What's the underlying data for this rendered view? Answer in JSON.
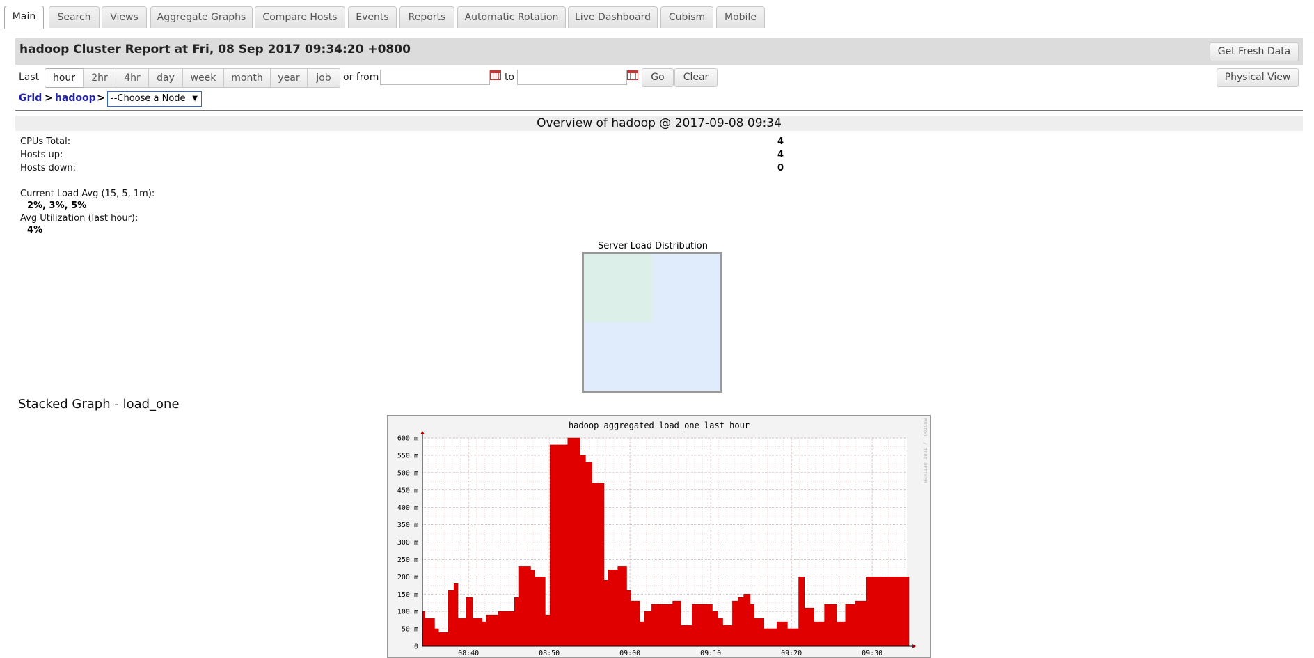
{
  "tabs": [
    {
      "label": "Main",
      "active": true
    },
    {
      "label": "Search"
    },
    {
      "label": "Views"
    },
    {
      "label": "Aggregate Graphs"
    },
    {
      "label": "Compare Hosts"
    },
    {
      "label": "Events"
    },
    {
      "label": "Reports"
    },
    {
      "label": "Automatic Rotation"
    },
    {
      "label": "Live Dashboard"
    },
    {
      "label": "Cubism"
    },
    {
      "label": "Mobile"
    }
  ],
  "header": {
    "title": "hadoop Cluster Report at Fri, 08 Sep 2017 09:34:20 +0800",
    "fresh_button": "Get Fresh Data",
    "physical_button": "Physical View"
  },
  "range": {
    "last_label": "Last",
    "options": [
      "hour",
      "2hr",
      "4hr",
      "day",
      "week",
      "month",
      "year",
      "job"
    ],
    "selected": "hour",
    "or_from_label": "or from",
    "to_label": "to",
    "from_value": "",
    "to_value": "",
    "go_button": "Go",
    "clear_button": "Clear"
  },
  "breadcrumb": {
    "grid": "Grid",
    "sep": ">",
    "cluster": "hadoop",
    "node_select": "--Choose a Node"
  },
  "overview": {
    "heading": "Overview of hadoop @ 2017-09-08 09:34",
    "cpus_label": "CPUs Total:",
    "cpus_value": "4",
    "hosts_up_label": "Hosts up:",
    "hosts_up_value": "4",
    "hosts_down_label": "Hosts down:",
    "hosts_down_value": "0",
    "load_label": "Current Load Avg (15, 5, 1m):",
    "load_value": "2%, 3%, 5%",
    "util_label": "Avg Utilization (last hour):",
    "util_value": "4%"
  },
  "server_load": {
    "title": "Server Load Distribution",
    "colors": {
      "idle": "#e0ebfc",
      "cell": "#dcefe8"
    }
  },
  "stacked_title": "Stacked Graph - load_one",
  "chart_data": {
    "type": "area",
    "title": "hadoop aggregated load_one last hour",
    "watermark": "RRDTOOL / TOBI OETIKER",
    "ylabel": "",
    "xlabel": "",
    "y_ticks": [
      "0",
      "50 m",
      "100 m",
      "150 m",
      "200 m",
      "250 m",
      "300 m",
      "350 m",
      "400 m",
      "450 m",
      "500 m",
      "550 m",
      "600 m"
    ],
    "ylim": [
      0,
      0.6
    ],
    "x_ticks": [
      "08:40",
      "08:50",
      "09:00",
      "09:10",
      "09:20",
      "09:30"
    ],
    "x_tick_minutes": [
      40,
      50,
      60,
      70,
      80,
      90
    ],
    "xlim_minutes": [
      34.3,
      94.3
    ],
    "color": "#e00000",
    "series": [
      {
        "minutes": [
          34.3,
          34.6,
          35.8,
          36.3,
          37.5,
          38.2,
          38.7,
          39.7,
          40.5,
          41.7,
          42.2,
          43.7,
          44.2,
          45.7,
          46.2,
          47.7,
          48.2,
          49.5,
          50.1,
          51.5,
          51.8,
          52.3,
          53.8,
          54.5,
          55.3,
          56.8,
          57.3,
          58.5,
          59.6,
          60.1,
          61.2,
          61.8,
          62.7,
          63.5,
          64.5,
          65.3,
          66.3,
          67.7,
          70.2,
          70.9,
          71.5,
          72.7,
          73.4,
          74.1,
          74.9,
          75.4,
          76.6,
          77.3,
          78.2,
          78.5,
          79.5,
          80.9,
          81.6,
          82.8,
          84.1,
          85.6,
          86.7,
          87.9,
          89.3,
          90.6,
          91.6,
          92.4,
          92.9,
          93.6,
          94.3
        ],
        "values": [
          0.1,
          0.08,
          0.05,
          0.04,
          0.16,
          0.18,
          0.08,
          0.14,
          0.08,
          0.07,
          0.09,
          0.1,
          0.1,
          0.14,
          0.23,
          0.22,
          0.2,
          0.09,
          0.58,
          0.58,
          0.58,
          0.6,
          0.55,
          0.53,
          0.47,
          0.19,
          0.22,
          0.23,
          0.16,
          0.13,
          0.07,
          0.1,
          0.12,
          0.12,
          0.12,
          0.13,
          0.06,
          0.12,
          0.1,
          0.08,
          0.06,
          0.13,
          0.14,
          0.15,
          0.12,
          0.08,
          0.05,
          0.05,
          0.07,
          0.07,
          0.05,
          0.2,
          0.11,
          0.07,
          0.12,
          0.07,
          0.12,
          0.13,
          0.2,
          0.2,
          0.2,
          0.2,
          0.2,
          0.2,
          0.2
        ]
      }
    ]
  }
}
